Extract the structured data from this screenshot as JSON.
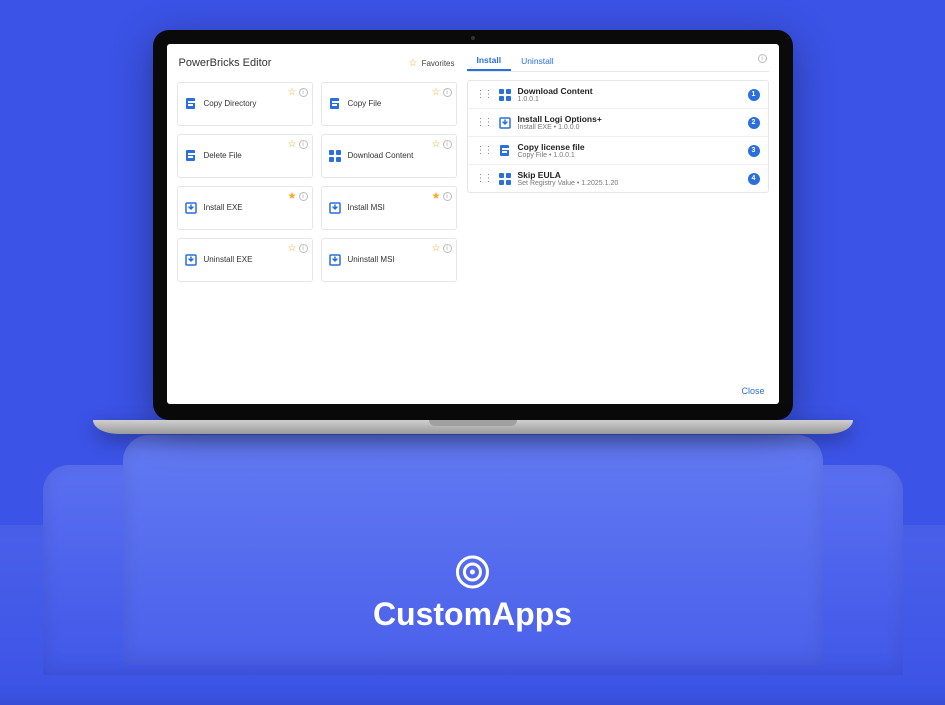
{
  "app": {
    "title": "PowerBricks Editor",
    "favorites_label": "Favorites",
    "close_label": "Close"
  },
  "brand": {
    "name": "CustomApps"
  },
  "tabs": {
    "install": "Install",
    "uninstall": "Uninstall"
  },
  "cards": [
    {
      "icon": "file-copy",
      "label": "Copy Directory",
      "star": "outline"
    },
    {
      "icon": "file-copy",
      "label": "Copy File",
      "star": "outline"
    },
    {
      "icon": "file-copy",
      "label": "Delete File",
      "star": "outline"
    },
    {
      "icon": "grid",
      "label": "Download Content",
      "star": "outline"
    },
    {
      "icon": "install",
      "label": "Install EXE",
      "star": "filled"
    },
    {
      "icon": "install",
      "label": "Install MSI",
      "star": "filled"
    },
    {
      "icon": "install",
      "label": "Uninstall EXE",
      "star": "outline"
    },
    {
      "icon": "install",
      "label": "Uninstall MSI",
      "star": "outline"
    }
  ],
  "sequence": [
    {
      "icon": "grid",
      "title": "Download Content",
      "sub": "1.0.0.1",
      "num": "1"
    },
    {
      "icon": "install",
      "title": "Install Logi Options+",
      "sub": "Install EXE • 1.0.0.0",
      "num": "2"
    },
    {
      "icon": "file-copy",
      "title": "Copy license file",
      "sub": "Copy File • 1.0.0.1",
      "num": "3"
    },
    {
      "icon": "grid",
      "title": "Skip EULA",
      "sub": "Set Registry Value • 1.2025.1.20",
      "num": "4"
    }
  ]
}
